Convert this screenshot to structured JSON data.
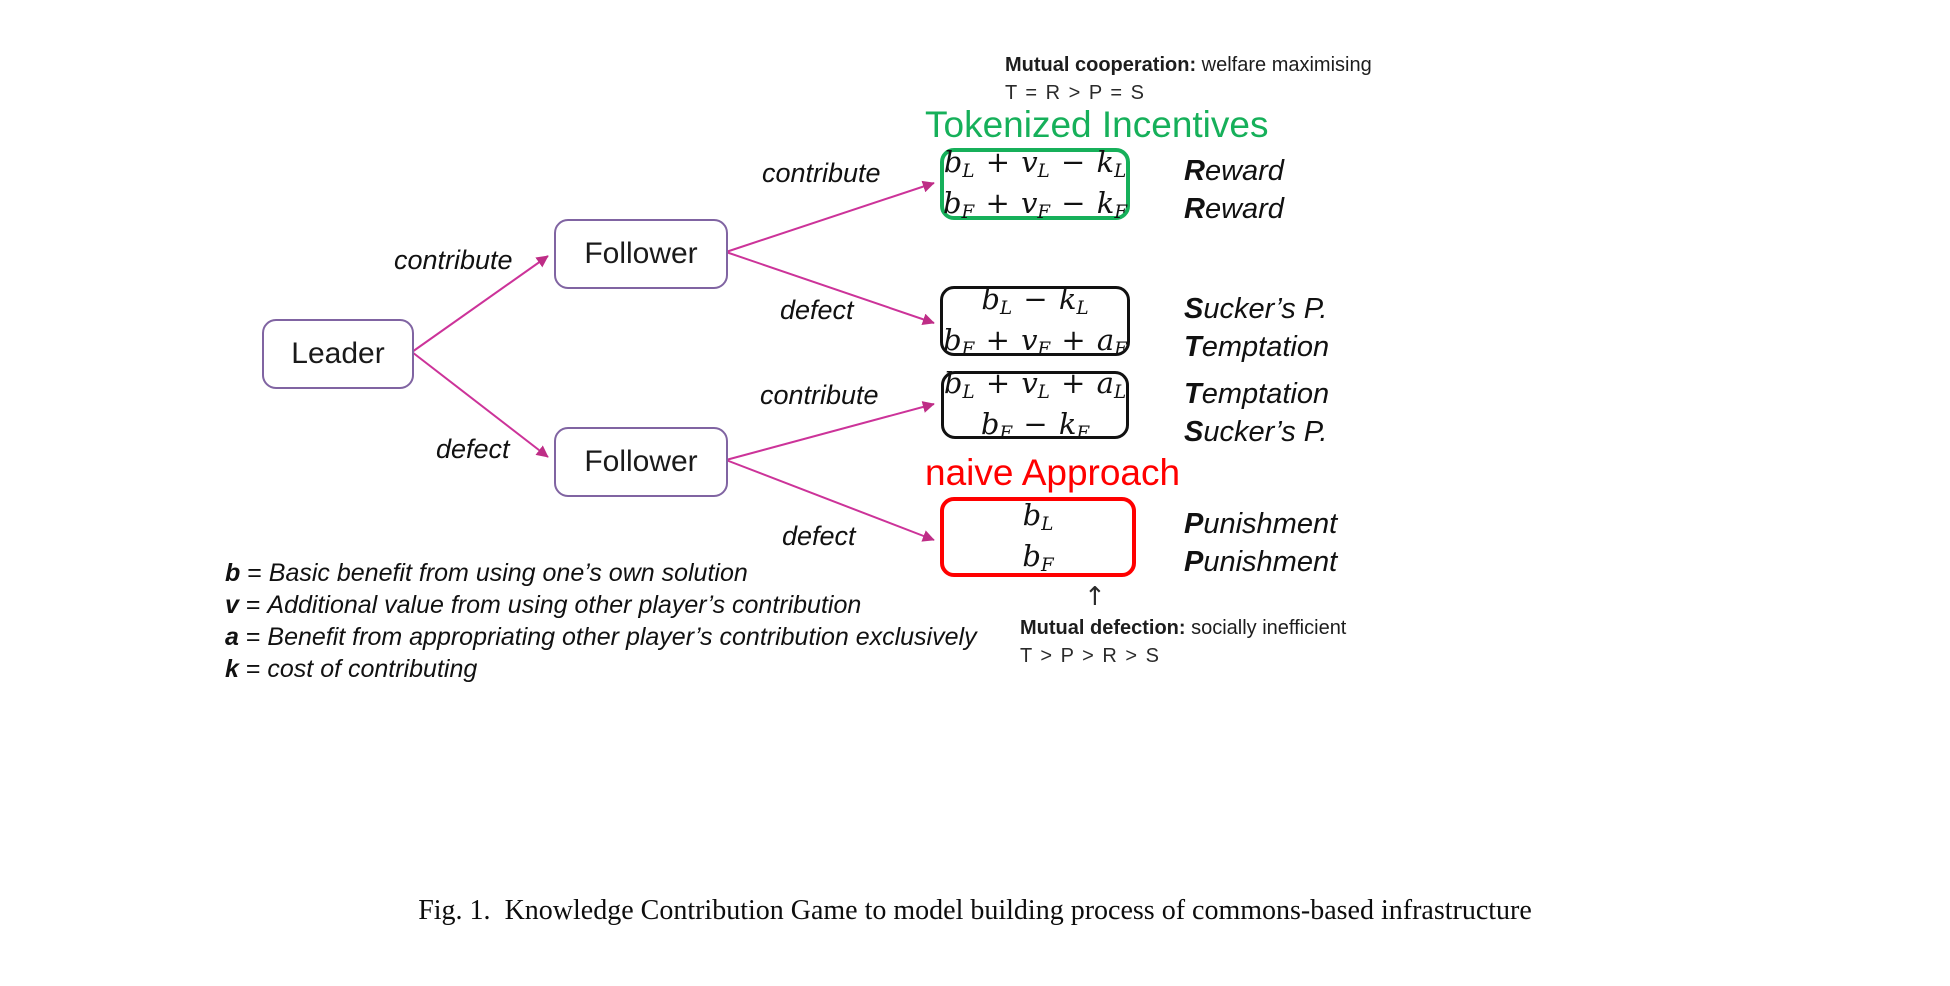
{
  "figure": {
    "caption_label": "Fig. 1.",
    "caption_text": "Knowledge Contribution Game to model building process of commons-based infrastructure"
  },
  "nodes": [
    {
      "id": "leader",
      "label": "Leader"
    },
    {
      "id": "follower-top",
      "label": "Follower"
    },
    {
      "id": "follower-bottom",
      "label": "Follower"
    }
  ],
  "edge_labels": [
    "contribute",
    "defect",
    "contribute",
    "defect",
    "contribute",
    "defect"
  ],
  "banners": {
    "green": "Tokenized Incentives",
    "red": "naive Approach",
    "green_color": "#16B05A",
    "red_color": "#FF0000"
  },
  "annotations": {
    "cooperation_bold": "Mutual cooperation:",
    "cooperation_rest": " welfare maximising",
    "cooperation_inequality": "T = R > P = S",
    "defection_bold": "Mutual defection:",
    "defection_rest": " socially inefficient",
    "defection_inequality": "T > P > R > S",
    "up_arrow": "↑"
  },
  "payoffs": [
    {
      "leader": "b_L + v_L − k_L",
      "follower": "b_F + v_F − k_F",
      "outcome_leader_initial": "R",
      "outcome_leader_rest": "eward",
      "outcome_follower_initial": "R",
      "outcome_follower_rest": "eward",
      "border_color": "#16B05A"
    },
    {
      "leader": "b_L − k_L",
      "follower": "b_F + v_F + a_F",
      "outcome_leader_initial": "S",
      "outcome_leader_rest": "ucker’s P.",
      "outcome_follower_initial": "T",
      "outcome_follower_rest": "emptation",
      "border_color": "#111111"
    },
    {
      "leader": "b_L + v_L + a_L",
      "follower": "b_F − k_F",
      "outcome_leader_initial": "T",
      "outcome_leader_rest": "emptation",
      "outcome_follower_initial": "S",
      "outcome_follower_rest": "ucker’s P.",
      "border_color": "#111111"
    },
    {
      "leader": "b_L",
      "follower": "b_F",
      "outcome_leader_initial": "P",
      "outcome_leader_rest": "unishment",
      "outcome_follower_initial": "P",
      "outcome_follower_rest": "unishment",
      "border_color": "#FF0000"
    }
  ],
  "legend": [
    {
      "symbol": "b",
      "eq": " = ",
      "desc": "Basic benefit from using one’s own solution"
    },
    {
      "symbol": "v",
      "eq": " = ",
      "desc": "Additional value from using other player’s contribution"
    },
    {
      "symbol": "a",
      "eq": " = ",
      "desc": "Benefit from appropriating other player’s contribution exclusively"
    },
    {
      "symbol": "k",
      "eq": " = ",
      "desc": "cost of contributing"
    }
  ],
  "edge_color": "#CC3399"
}
